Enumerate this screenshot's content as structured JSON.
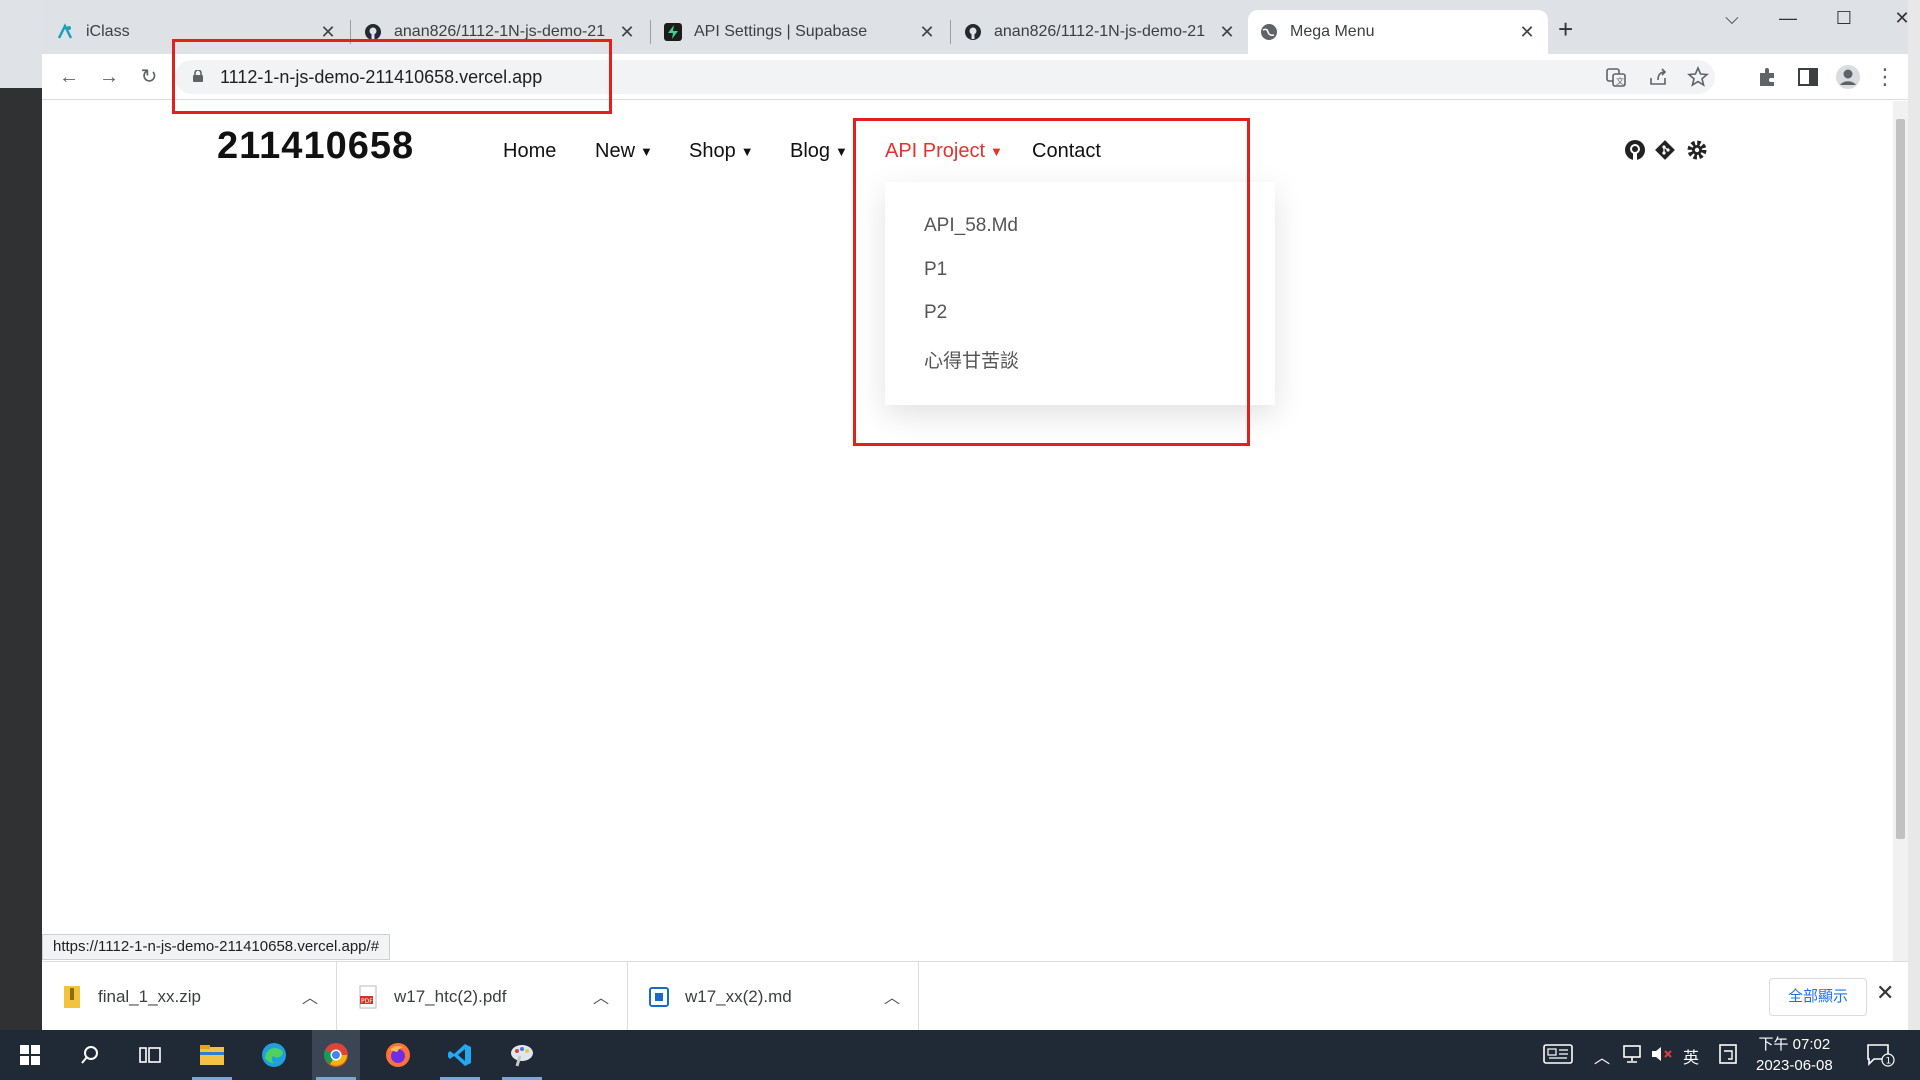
{
  "browser": {
    "tabs": [
      {
        "title": "iClass",
        "icon": "iclass-icon"
      },
      {
        "title": "anan826/1112-1N-js-demo-21",
        "icon": "github-icon"
      },
      {
        "title": "API Settings | Supabase",
        "icon": "supabase-icon"
      },
      {
        "title": "anan826/1112-1N-js-demo-21",
        "icon": "github-icon"
      },
      {
        "title": "Mega Menu",
        "icon": "globe-icon",
        "active": true
      }
    ],
    "address": "1112-1-n-js-demo-211410658.vercel.app",
    "status_url": "https://1112-1-n-js-demo-211410658.vercel.app/#"
  },
  "site": {
    "brand": "211410658",
    "nav": [
      {
        "label": "Home",
        "has_dropdown": false
      },
      {
        "label": "New",
        "has_dropdown": true
      },
      {
        "label": "Shop",
        "has_dropdown": true
      },
      {
        "label": "Blog",
        "has_dropdown": true
      },
      {
        "label": "API Project",
        "has_dropdown": true,
        "active": true
      },
      {
        "label": "Contact",
        "has_dropdown": false
      }
    ],
    "dropdown_items": [
      "API_58.Md",
      "P1",
      "P2",
      "心得甘苦談"
    ],
    "accent_color": "#e4322d",
    "highlight_color": "#e0211d"
  },
  "downloads": {
    "items": [
      {
        "name": "final_1_xx.zip",
        "type": "zip"
      },
      {
        "name": "w17_htc(2).pdf",
        "type": "pdf"
      },
      {
        "name": "w17_xx(2).md",
        "type": "md"
      }
    ],
    "show_all": "全部顯示"
  },
  "taskbar": {
    "ime": "英",
    "time": "下午 07:02",
    "date": "2023-06-08",
    "notifications": "1"
  }
}
